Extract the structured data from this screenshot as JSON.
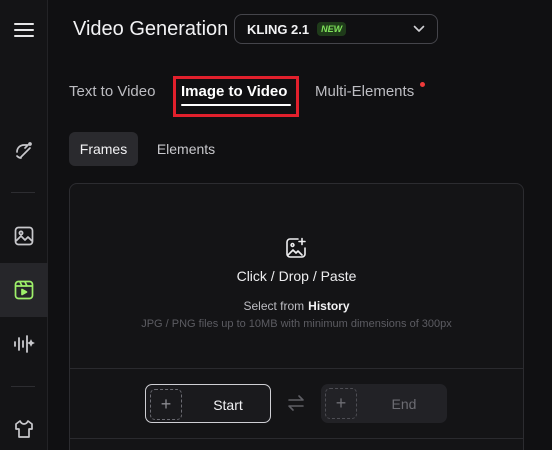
{
  "header": {
    "title": "Video Generation",
    "model_name": "KLING 2.1",
    "model_badge": "NEW"
  },
  "tabs": [
    {
      "label": "Text to Video",
      "active": false
    },
    {
      "label": "Image to Video",
      "active": true
    },
    {
      "label": "Multi-Elements",
      "active": false,
      "notification_dot": true
    }
  ],
  "subtabs": [
    {
      "label": "Frames",
      "active": true
    },
    {
      "label": "Elements",
      "active": false
    }
  ],
  "upload": {
    "title": "Click / Drop / Paste",
    "select_prefix": "Select from",
    "select_link": "History",
    "spec": "JPG / PNG files up to 10MB with minimum dimensions of 300px"
  },
  "frames": {
    "start_label": "Start",
    "end_label": "End"
  },
  "sidebar": {
    "items": [
      {
        "icon": "menu-icon"
      },
      {
        "icon": "magic-brush-icon"
      },
      {
        "icon": "image-icon"
      },
      {
        "icon": "video-icon",
        "active": true
      },
      {
        "icon": "audio-wave-icon"
      },
      {
        "icon": "shirt-icon"
      }
    ]
  },
  "colors": {
    "background": "#101012",
    "accent_green": "#7fe25a",
    "highlight_red": "#e2202c"
  }
}
